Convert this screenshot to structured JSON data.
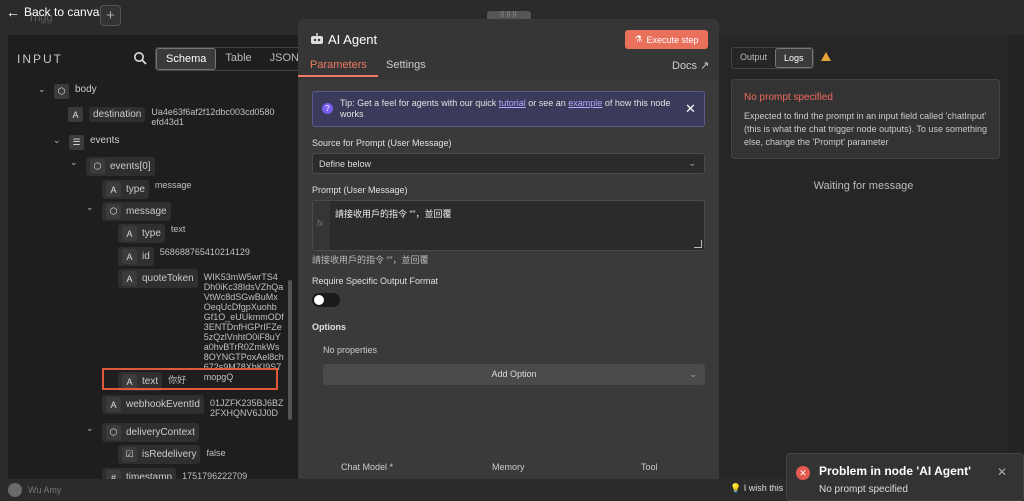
{
  "topbar": {
    "back_label": "Back to canvas",
    "add_label": "+",
    "ghost_label": "Trigg"
  },
  "input_panel": {
    "title": "INPUT",
    "view_tabs": [
      "Schema",
      "Table",
      "JSON"
    ],
    "tree": {
      "body": "body",
      "destination_key": "destination",
      "destination_val": "Ua4e63f6af2f12dbc003cd0580\nefd43d1",
      "events": "events",
      "events0": "events[0]",
      "type_key": "type",
      "type_val": "message",
      "message": "message",
      "msg_type_key": "type",
      "msg_type_val": "text",
      "id_key": "id",
      "id_val": "568688765410214129",
      "quote_key": "quoteToken",
      "quote_val": "WIK53mW5wrTS4\nDh0iKc38IdsVZhQa\nVtWc8dSGwBuMx\nOeqUcDfgpXuohb\nGf1O_eUUkmmODf\n3ENTDnfHGPrIFZe\n5zQzlVnhtO0iF8uY\na0hvBTrR0ZmkWs\n8OYNGTPoxAel8ch\n672s9M78XbKI9S7\nmopgQ",
      "text_key": "text",
      "text_val": "你好",
      "webhook_key": "webhookEventId",
      "webhook_val": "01JZFK235BJ6BZ\n2FXHQNV6JJ0D",
      "delivery": "deliveryContext",
      "redelivery_key": "isRedelivery",
      "redelivery_val": "false",
      "timestamp_key": "timestamp",
      "timestamp_val": "1751796222709"
    }
  },
  "node": {
    "title": "AI Agent",
    "execute_label": "Execute step",
    "tabs": [
      "Parameters",
      "Settings"
    ],
    "docs_label": "Docs",
    "tip_prefix": "Tip: Get a feel for agents with our quick ",
    "tip_link1": "tutorial",
    "tip_mid": " or see an ",
    "tip_link2": "example",
    "tip_suffix": " of how this node works",
    "source_label": "Source for Prompt (User Message)",
    "source_value": "Define below",
    "prompt_label": "Prompt (User Message)",
    "prompt_value": "請接收用戶的指令 “”，並回覆",
    "prompt_preview": "請接收用戶的指令 “”，並回覆",
    "require_label": "Require Specific Output Format",
    "options_label": "Options",
    "no_props": "No properties",
    "add_option": "Add Option",
    "sub_nodes": [
      "Chat Model *",
      "Memory",
      "Tool"
    ]
  },
  "output_panel": {
    "tabs": [
      "Output",
      "Logs"
    ],
    "error_title": "No prompt specified",
    "error_desc": "Expected to find the prompt in an input field called 'chatInput' (this is what the chat trigger node outputs). To use something else, change the 'Prompt' parameter",
    "waiting": "Waiting for message"
  },
  "bottom": {
    "user": "Wu Amy",
    "wish": "I wish this"
  },
  "toast": {
    "title": "Problem in node 'AI Agent'",
    "message": "No prompt specified"
  },
  "colors": {
    "accent": "#f07a63",
    "error": "#e55a4e",
    "warning": "#e8a43a"
  }
}
